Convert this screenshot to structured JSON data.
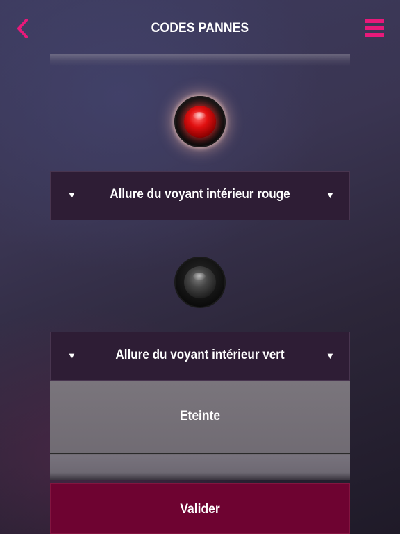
{
  "header": {
    "title": "CODES PANNES",
    "back_icon": "chevron-left-icon",
    "menu_icon": "hamburger-menu-icon",
    "accent_color": "#e8197a"
  },
  "leds": {
    "interior_red": {
      "color": "red",
      "state": "lit"
    },
    "interior_green": {
      "color": "grey",
      "state": "off"
    }
  },
  "dropdowns": {
    "red": {
      "label": "Allure du voyant intérieur rouge",
      "arrow_icon": "triangle-down-icon"
    },
    "green": {
      "label": "Allure du voyant intérieur vert",
      "arrow_icon": "triangle-down-icon"
    }
  },
  "picker": {
    "options": [
      "Eteinte",
      ""
    ]
  },
  "actions": {
    "submit_label": "Valider",
    "submit_color": "#6e0331"
  }
}
